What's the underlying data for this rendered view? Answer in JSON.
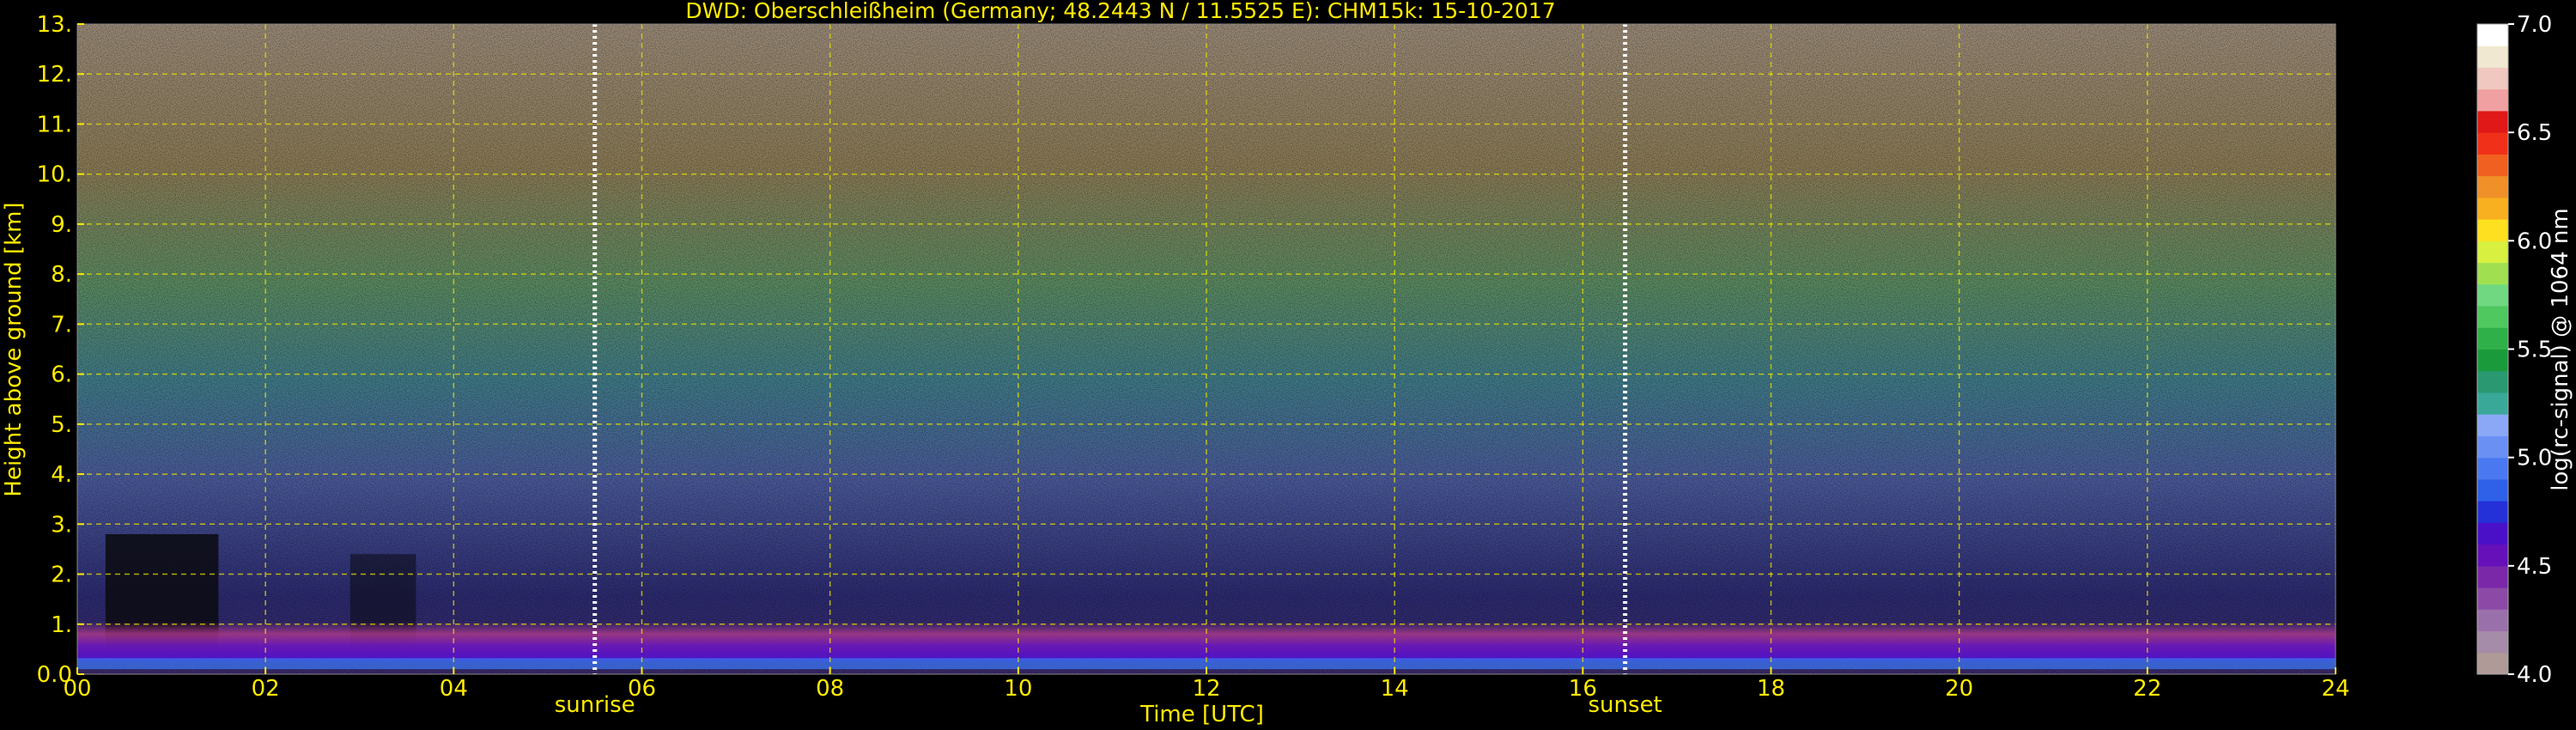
{
  "chart_data": {
    "type": "heatmap",
    "title": "DWD: Oberschleißheim (Germany; 48.2443 N / 11.5525 E):    CHM15k: 15-10-2017",
    "xlabel": "Time [UTC]",
    "ylabel": "Height above ground [km]",
    "xlim": [
      0,
      24
    ],
    "ylim": [
      0,
      13
    ],
    "x_ticks": [
      "00",
      "02",
      "04",
      "06",
      "08",
      "10",
      "12",
      "14",
      "16",
      "18",
      "20",
      "22",
      "24"
    ],
    "y_ticks": [
      "0.0",
      "1.",
      "2.",
      "3.",
      "4.",
      "5.",
      "6.",
      "7.",
      "8.",
      "9.",
      "10.",
      "11.",
      "12.",
      "13."
    ],
    "grid": true,
    "markers": [
      {
        "label": "sunrise",
        "x": 5.5
      },
      {
        "label": "sunset",
        "x": 16.45
      }
    ],
    "colorbar": {
      "label": "log(rc-signal) @ 1064 nm",
      "range": [
        4.0,
        7.0
      ],
      "ticks": [
        "4.0",
        "4.5",
        "5.0",
        "5.5",
        "6.0",
        "6.5",
        "7.0"
      ],
      "colors": [
        "#b09a98",
        "#a58ca8",
        "#9a70aa",
        "#8c4aa6",
        "#7a28a8",
        "#6510b8",
        "#4a10c8",
        "#2430d8",
        "#2e60e8",
        "#4a78f0",
        "#6a90f4",
        "#8aa8f6",
        "#3aa898",
        "#2a9870",
        "#1a9a3a",
        "#30b048",
        "#50c860",
        "#70d880",
        "#a0e050",
        "#d8f040",
        "#ffe020",
        "#f8b020",
        "#f09028",
        "#f06020",
        "#f03018",
        "#e01818",
        "#f0a0a0",
        "#f0c8c0",
        "#f0e8d0",
        "#ffffff"
      ]
    }
  }
}
